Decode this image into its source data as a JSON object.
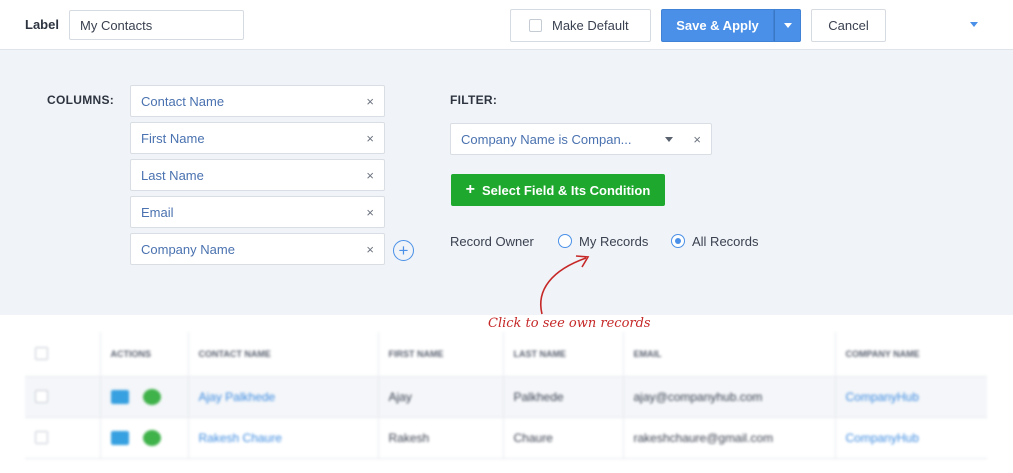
{
  "toolbar": {
    "label_text": "Label",
    "label_value": "My Contacts",
    "make_default_label": "Make Default",
    "save_apply_label": "Save & Apply",
    "cancel_label": "Cancel"
  },
  "columns": {
    "title": "COLUMNS:",
    "items": [
      {
        "label": "Contact Name"
      },
      {
        "label": "First Name"
      },
      {
        "label": "Last Name"
      },
      {
        "label": "Email"
      },
      {
        "label": "Company Name"
      }
    ],
    "remove_glyph": "×",
    "add_glyph": "+"
  },
  "filter": {
    "title": "FILTER:",
    "condition": "Company Name is Compan...",
    "add_button_label": "Select Field & Its Condition",
    "add_button_glyph": "+",
    "record_owner_label": "Record Owner",
    "options": [
      {
        "label": "My Records",
        "selected": false
      },
      {
        "label": "All Records",
        "selected": true
      }
    ]
  },
  "annotation": "Click to see own records",
  "table": {
    "headers": [
      "",
      "ACTIONS",
      "CONTACT NAME",
      "FIRST NAME",
      "LAST NAME",
      "EMAIL",
      "COMPANY NAME"
    ],
    "rows": [
      {
        "contact_name": "Ajay Palkhede",
        "first_name": "Ajay",
        "last_name": "Palkhede",
        "email": "ajay@companyhub.com",
        "company": "CompanyHub"
      },
      {
        "contact_name": "Rakesh Chaure",
        "first_name": "Rakesh",
        "last_name": "Chaure",
        "email": "rakeshchaure@gmail.com",
        "company": "CompanyHub"
      }
    ]
  },
  "colors": {
    "primary": "#4a90e8",
    "success": "#1fa82e",
    "annotation": "#c62828",
    "panel_bg": "#f0f3f7"
  },
  "icons": {
    "dropdown": "chevron-down-icon",
    "remove": "close-icon",
    "add": "plus-circle-icon",
    "mail": "mail-icon",
    "chat": "chat-icon"
  }
}
